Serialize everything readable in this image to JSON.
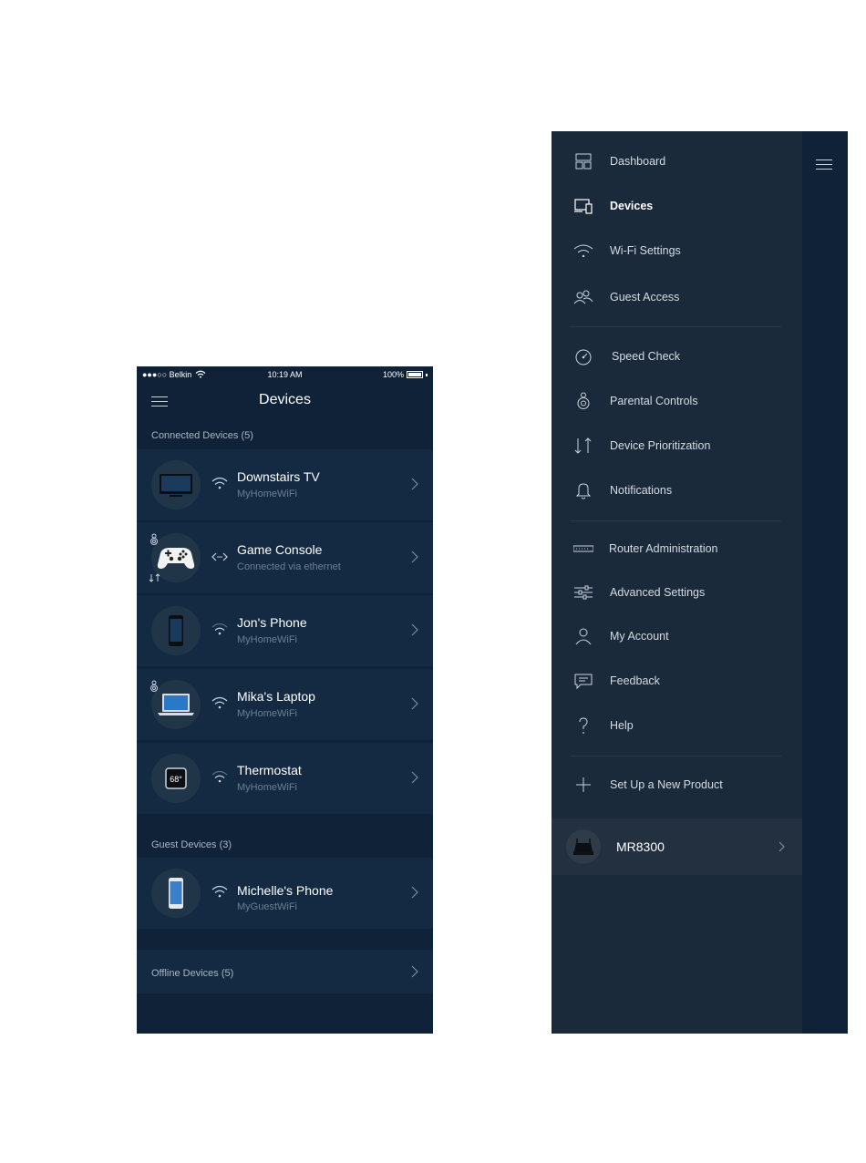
{
  "status_bar": {
    "carrier": "●●●○○ Belkin",
    "time": "10:19 AM",
    "battery": "100%"
  },
  "devices_screen": {
    "title": "Devices",
    "connected_header": "Connected Devices (5)",
    "connected": [
      {
        "name": "Downstairs TV",
        "network": "MyHomeWiFi",
        "icon": "tv-icon",
        "connection": "wifi"
      },
      {
        "name": "Game Console",
        "network": "Connected via ethernet",
        "icon": "game-controller-icon",
        "connection": "ethernet"
      },
      {
        "name": "Jon's Phone",
        "network": "MyHomeWiFi",
        "icon": "phone-icon",
        "connection": "wifi"
      },
      {
        "name": "Mika's Laptop",
        "network": "MyHomeWiFi",
        "icon": "laptop-icon",
        "connection": "wifi"
      },
      {
        "name": "Thermostat",
        "network": "MyHomeWiFi",
        "icon": "thermostat-icon",
        "connection": "wifi",
        "reading": "68°"
      }
    ],
    "guest_header": "Guest Devices  (3)",
    "guest": [
      {
        "name": "Michelle's Phone",
        "network": "MyGuestWiFi",
        "icon": "phone-icon",
        "connection": "wifi"
      }
    ],
    "offline_header": "Offline Devices  (5)"
  },
  "side_menu": {
    "items": [
      {
        "label": "Dashboard",
        "icon": "dashboard-icon"
      },
      {
        "label": "Devices",
        "icon": "devices-icon",
        "active": true
      },
      {
        "label": "Wi-Fi Settings",
        "icon": "wifi-icon"
      },
      {
        "label": "Guest Access",
        "icon": "guest-access-icon"
      },
      {
        "label": "Speed Check",
        "icon": "speed-check-icon"
      },
      {
        "label": "Parental Controls",
        "icon": "parental-controls-icon"
      },
      {
        "label": "Device Prioritization",
        "icon": "prioritization-icon"
      },
      {
        "label": "Notifications",
        "icon": "bell-icon"
      },
      {
        "label": "Router Administration",
        "icon": "router-icon"
      },
      {
        "label": "Advanced Settings",
        "icon": "sliders-icon"
      },
      {
        "label": "My Account",
        "icon": "user-icon"
      },
      {
        "label": "Feedback",
        "icon": "feedback-icon"
      },
      {
        "label": "Help",
        "icon": "help-icon"
      },
      {
        "label": "Set Up a New Product",
        "icon": "plus-icon"
      }
    ],
    "router": {
      "name": "MR8300"
    }
  },
  "colors": {
    "background": "#0f2237",
    "drawer": "#1b2a3a",
    "row": "#132a42",
    "muted_text": "#6d7f92"
  }
}
